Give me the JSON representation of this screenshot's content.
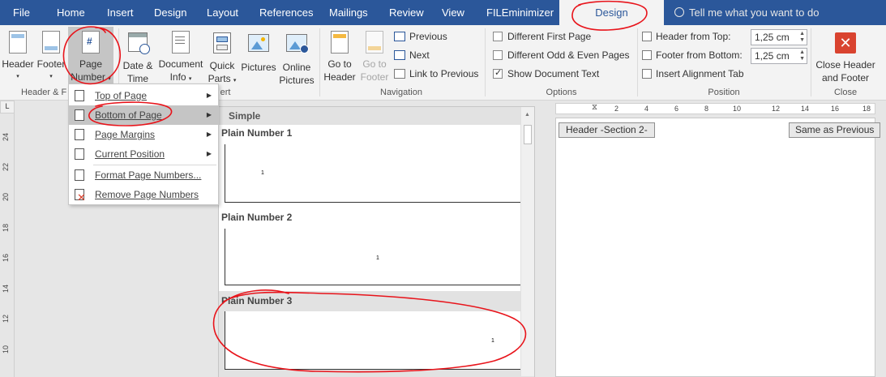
{
  "tabs": [
    "File",
    "Home",
    "Insert",
    "Design",
    "Layout",
    "References",
    "Mailings",
    "Review",
    "View",
    "FILEminimizer"
  ],
  "active_tab": "Design",
  "tell_me": "Tell me what you want to do",
  "ribbon": {
    "header_footer": {
      "header": "Header",
      "footer": "Footer",
      "page_number_1": "Page",
      "page_number_2": "Number",
      "group_label": "Header & F"
    },
    "insert": {
      "date_time_1": "Date &",
      "date_time_2": "Time",
      "doc_info_1": "Document",
      "doc_info_2": "Info",
      "quick_parts_1": "Quick",
      "quick_parts_2": "Parts",
      "pictures": "Pictures",
      "online_pictures_1": "Online",
      "online_pictures_2": "Pictures",
      "group_label": "ert"
    },
    "navigation": {
      "go_to_header_1": "Go to",
      "go_to_header_2": "Header",
      "go_to_footer_1": "Go to",
      "go_to_footer_2": "Footer",
      "previous": "Previous",
      "next": "Next",
      "link_to_previous": "Link to Previous",
      "group_label": "Navigation"
    },
    "options": {
      "different_first_page": "Different First Page",
      "different_odd_even": "Different Odd & Even Pages",
      "show_document_text": "Show Document Text",
      "group_label": "Options"
    },
    "position": {
      "header_from_top": "Header from Top:",
      "header_from_top_value": "1,25 cm",
      "footer_from_bottom": "Footer from Bottom:",
      "footer_from_bottom_value": "1,25 cm",
      "insert_alignment_tab": "Insert Alignment Tab",
      "group_label": "Position"
    },
    "close": {
      "close_1": "Close Header",
      "close_2": "and Footer",
      "group_label": "Close"
    }
  },
  "menu": {
    "top_of_page": "Top of Page",
    "bottom_of_page": "Bottom of Page",
    "page_margins": "Page Margins",
    "current_position": "Current Position",
    "format_page_numbers": "Format Page Numbers...",
    "remove_page_numbers": "Remove Page Numbers"
  },
  "gallery": {
    "heading": "Simple",
    "item1": "Plain Number 1",
    "item2": "Plain Number 2",
    "item3": "Plain Number 3",
    "preview_number": "1"
  },
  "document": {
    "header_tag": "Header -Section 2-",
    "same_as_previous": "Same as Previous"
  },
  "rulers": {
    "vertical": [
      "24",
      "22",
      "20",
      "18",
      "16",
      "14",
      "12",
      "10"
    ],
    "horizontal": [
      "2",
      "4",
      "6",
      "8",
      "10",
      "12",
      "14",
      "16",
      "18"
    ],
    "corner": "L"
  },
  "colors": {
    "tab_bar": "#2b579a",
    "annotation": "#e8141b",
    "close_icon": "#d9432f"
  }
}
